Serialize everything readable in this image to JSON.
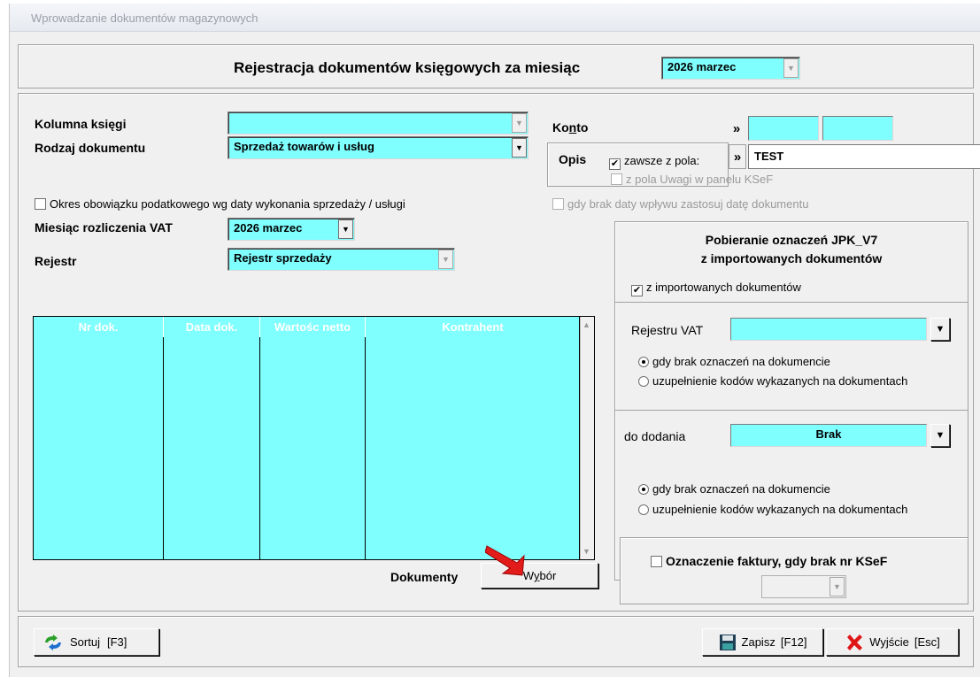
{
  "window": {
    "title": "Wprowadzanie dokumentów magazynowych"
  },
  "header": {
    "label": "Rejestracja dokumentów księgowych za miesiąc",
    "month": "2026 marzec"
  },
  "left": {
    "kolumna_label": "Kolumna księgi",
    "kolumna_value": "",
    "rodzaj_label": "Rodzaj dokumentu",
    "rodzaj_value": "Sprzedaż towarów i usług",
    "okres_label": "Okres obowiązku podatkowego wg daty wykonania sprzedaży / usługi",
    "miesiac_label": "Miesiąc rozliczenia VAT",
    "miesiac_value": "2026 marzec",
    "rejestr_label": "Rejestr",
    "rejestr_value": "Rejestr sprzedaży"
  },
  "konto": {
    "label_pre": "Ko",
    "label_u": "n",
    "label_post": "to",
    "value1": "",
    "value2": ""
  },
  "opis": {
    "label": "Opis",
    "zawsze_label": "zawsze z pola:",
    "zawsze_checked": "✔",
    "value": "TEST",
    "uwagi_label": "z pola Uwagi w panelu KSeF",
    "gdy_brak_label": "gdy brak daty wpływu zastosuj datę dokumentu"
  },
  "table": {
    "columns": [
      "Nr dok.",
      "Data dok.",
      "Wartośc netto",
      "Kontrahent"
    ],
    "rows": []
  },
  "documents": {
    "label": "Dokumenty",
    "button_pre": "W",
    "button_u": "y",
    "button_post": "bór"
  },
  "jpk": {
    "title_line1": "Pobieranie oznaczeń JPK_V7",
    "title_line2": "z importowanych dokumentów",
    "import_label": "z importowanych dokumentów",
    "import_checked": "✔",
    "rejestr_label": "Rejestru VAT",
    "rejestr_value": "",
    "radio1_a": "gdy brak oznaczeń na dokumencie",
    "radio1_b": "uzupełnienie kodów wykazanych na dokumentach",
    "dodania_label": "do dodania",
    "dodania_value": "Brak",
    "radio2_a": "gdy brak oznaczeń na dokumencie",
    "radio2_b": "uzupełnienie kodów wykazanych na dokumentach"
  },
  "ksef": {
    "label": "Oznaczenie faktury, gdy brak nr KSeF",
    "value": ""
  },
  "footer": {
    "sort_label": "Sortuj",
    "sort_key": "[F3]",
    "save_label": "Zapisz",
    "save_key": "[F12]",
    "exit_label": "Wyjście",
    "exit_key": "[Esc]"
  },
  "colors": {
    "field": "#80ffff",
    "window": "#f0f0f0",
    "header": "#000000"
  }
}
